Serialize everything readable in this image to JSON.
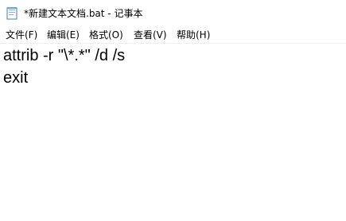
{
  "window": {
    "title": "*新建文本文档.bat - 记事本",
    "icon": "notepad-icon"
  },
  "menu": {
    "file": "文件(F)",
    "edit": "编辑(E)",
    "format": "格式(O)",
    "view": "查看(V)",
    "help": "帮助(H)"
  },
  "editor": {
    "lines": [
      "attrib -r \"\\*.*\" /d /s",
      "exit"
    ]
  }
}
